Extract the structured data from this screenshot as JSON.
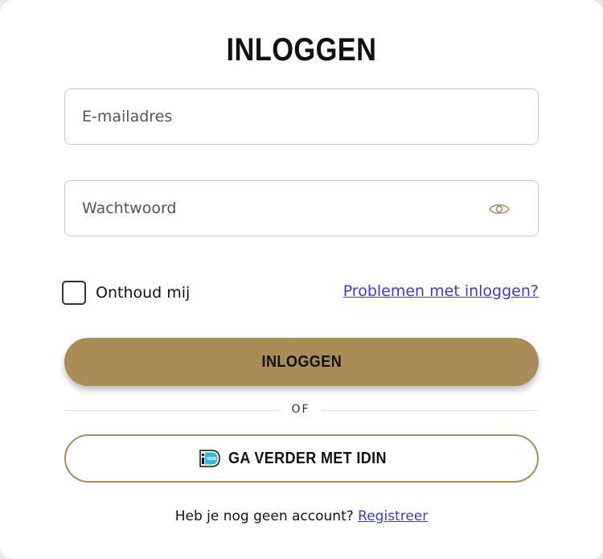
{
  "login": {
    "title": "INLOGGEN",
    "email": {
      "placeholder": "E-mailadres",
      "value": ""
    },
    "password": {
      "placeholder": "Wachtwoord",
      "value": ""
    },
    "remember_label": "Onthoud mij",
    "remember_checked": false,
    "forgot_link": "Problemen met inloggen?",
    "submit_label": "INLOGGEN",
    "divider_text": "OF",
    "idin_label": "GA VERDER MET IDIN",
    "idin_icon": "idin-logo-icon",
    "password_toggle_icon": "eye-icon",
    "signup_text": "Heb je nog geen account?",
    "signup_link": "Registreer"
  },
  "colors": {
    "accent": "#a98c58",
    "link": "#3d3cc9",
    "idin_blue": "#2fb8e8"
  }
}
